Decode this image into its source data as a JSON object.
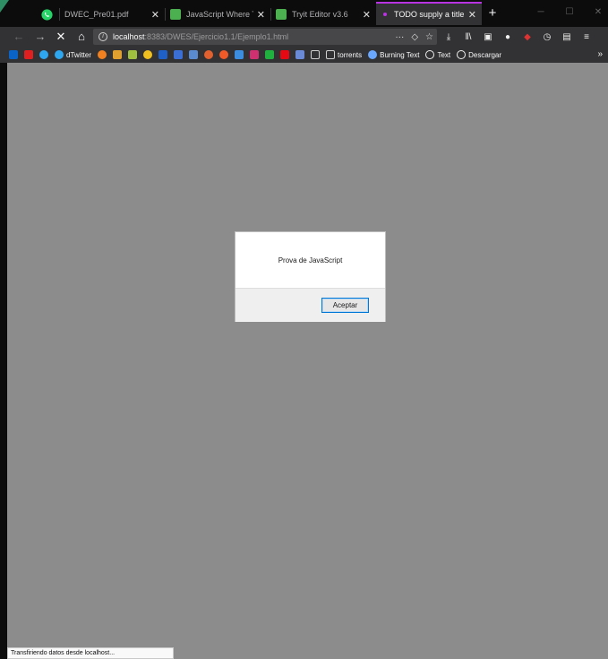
{
  "tabs": [
    {
      "title": "",
      "pinned": true,
      "icon": "whatsapp-icon",
      "color": "#25d366"
    },
    {
      "title": "DWEC_Pre01.pdf",
      "icon": "none",
      "color": ""
    },
    {
      "title": "JavaScript Where To",
      "icon": "w3schools-icon",
      "color": "#4caf50"
    },
    {
      "title": "Tryit Editor v3.6",
      "icon": "w3schools-icon",
      "color": "#4caf50"
    },
    {
      "title": "TODO supply a title",
      "icon": "loading-dot",
      "color": "#b833e1",
      "active": true
    }
  ],
  "navbar": {
    "url_host": "localhost",
    "url_path": ":8383/DWES/Ejercicio1.1/Ejemplo1.html"
  },
  "bookmarks": {
    "items": [
      {
        "label": "dTwitter",
        "icon": "github-icon",
        "color": "#2ea6f0"
      },
      {
        "label": "torrents",
        "icon": "folder-icon",
        "color": "#d0d0d0"
      },
      {
        "label": "Burning Text",
        "icon": "burning-text-icon",
        "color": "#6aa8ff"
      },
      {
        "label": "Text",
        "icon": "globe-icon",
        "color": "#f0f0f0"
      },
      {
        "label": "Descargar",
        "icon": "globe-icon",
        "color": "#f0f0f0"
      }
    ]
  },
  "dialog": {
    "message": "Prova de JavaScript",
    "ok_label": "Aceptar"
  },
  "status": {
    "text": "Transfiriendo datos desde localhost..."
  },
  "colors": {
    "accent": "#b833e1",
    "content_bg": "#8c8c8c",
    "chrome_bg": "#323234"
  }
}
